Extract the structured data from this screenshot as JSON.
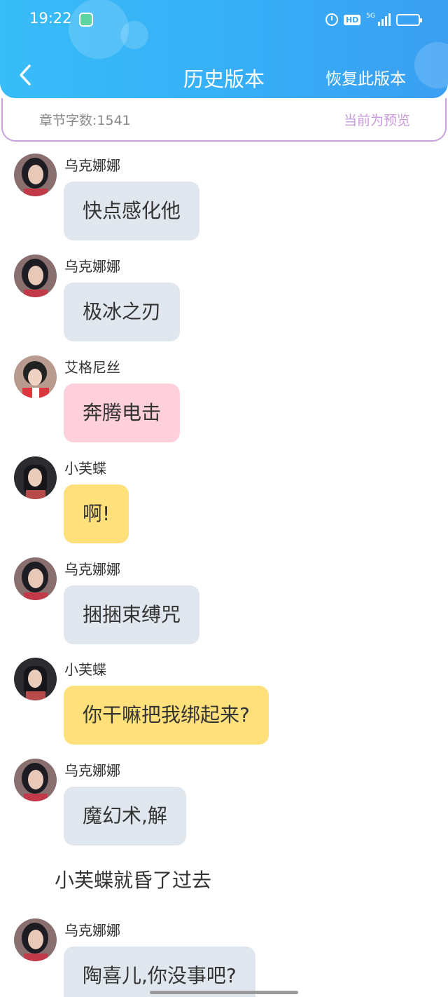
{
  "status_bar": {
    "time": "19:22",
    "hd_label": "HD",
    "network_label": "5G",
    "battery_level": 0.4
  },
  "header": {
    "back_icon": "chevron-left-icon",
    "title": "历史版本",
    "restore_label": "恢复此版本"
  },
  "info_bar": {
    "word_count": "章节字数:1541",
    "preview_status": "当前为预览"
  },
  "colors": {
    "header_accent": "#36aef6",
    "preview_accent": "#c99ad8",
    "bubble_gray": "#e1e7ee",
    "bubble_pink": "#ffd0dc",
    "bubble_yellow": "#ffe07a"
  },
  "messages": [
    {
      "sender": "乌克娜娜",
      "text": "快点感化他"
    },
    {
      "sender": "乌克娜娜",
      "text": "极冰之刃"
    },
    {
      "sender": "艾格尼丝",
      "text": "奔腾电击"
    },
    {
      "sender": "小芙蝶",
      "text": "啊!"
    },
    {
      "sender": "乌克娜娜",
      "text": "捆捆束缚咒"
    },
    {
      "sender": "小芙蝶",
      "text": "你干嘛把我绑起来?"
    },
    {
      "sender": "乌克娜娜",
      "text": "魔幻术,解"
    },
    {
      "sender": "乌克娜娜",
      "text": "陶喜儿,你没事吧?"
    }
  ],
  "narration": "小芙蝶就昏了过去"
}
